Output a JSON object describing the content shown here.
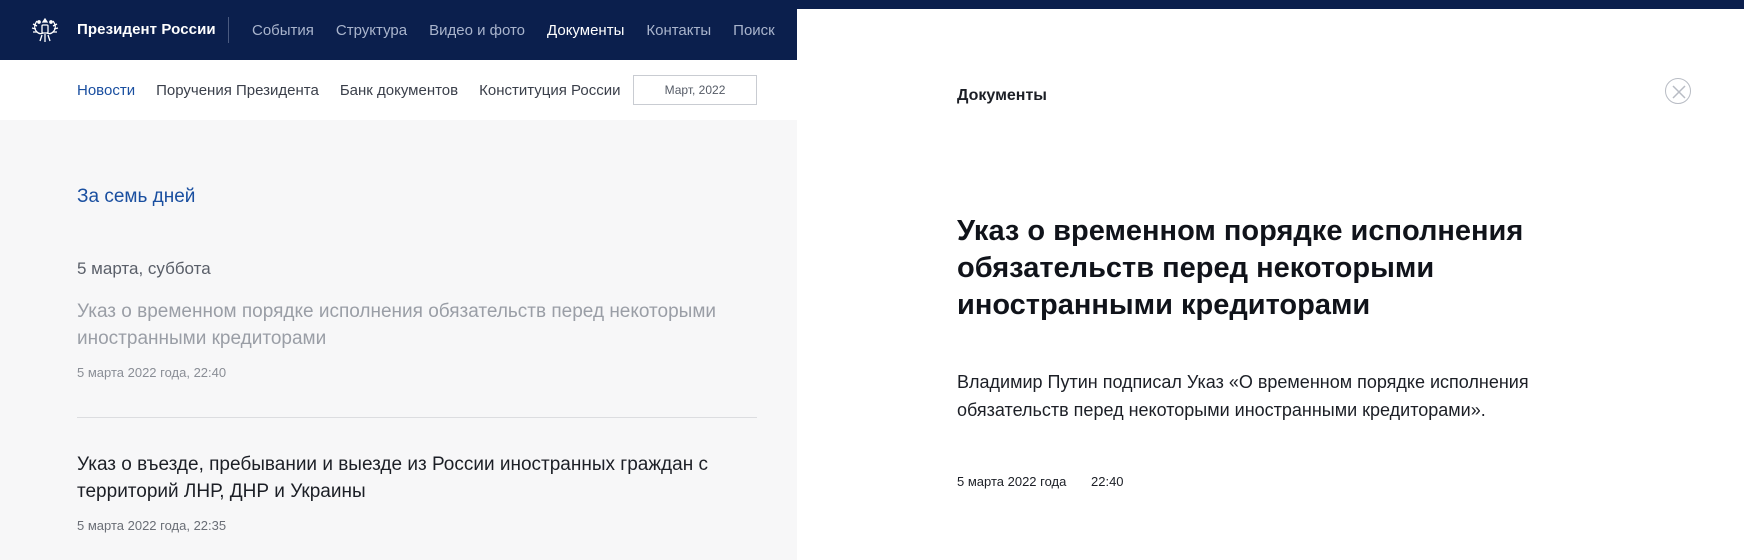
{
  "header": {
    "site_title": "Президент России",
    "nav": [
      "События",
      "Структура",
      "Видео и фото",
      "Документы",
      "Контакты",
      "Поиск"
    ],
    "active_nav": "Документы"
  },
  "subnav": {
    "items": [
      "Новости",
      "Поручения Президента",
      "Банк документов",
      "Конституция России"
    ],
    "active": "Новости",
    "date_picker": "Март, 2022"
  },
  "feed": {
    "period_link": "За семь дней",
    "day_heading": "5 марта, суббота",
    "items": [
      {
        "title": "Указ о временном порядке исполнения обязательств перед некоторыми иностранными кредиторами",
        "date": "5 марта 2022 года, 22:40"
      },
      {
        "title": "Указ о въезде, пребывании и выезде из России иностранных граждан с территорий ЛНР, ДНР и Украины",
        "date": "5 марта 2022 года, 22:35"
      }
    ]
  },
  "document": {
    "section": "Документы",
    "title": "Указ о временном порядке исполнения обязательств перед некоторыми иностранными кредиторами",
    "lead": "Владимир Путин подписал Указ «О временном порядке исполнения обязательств перед некоторыми иностранными кредиторами».",
    "date": "5 марта 2022 года",
    "time": "22:40"
  },
  "icons": {
    "emblem": "double-headed-eagle-icon",
    "close": "close-icon"
  },
  "colors": {
    "header_bg": "#0b1f4d",
    "accent_link": "#1a4fa0"
  }
}
